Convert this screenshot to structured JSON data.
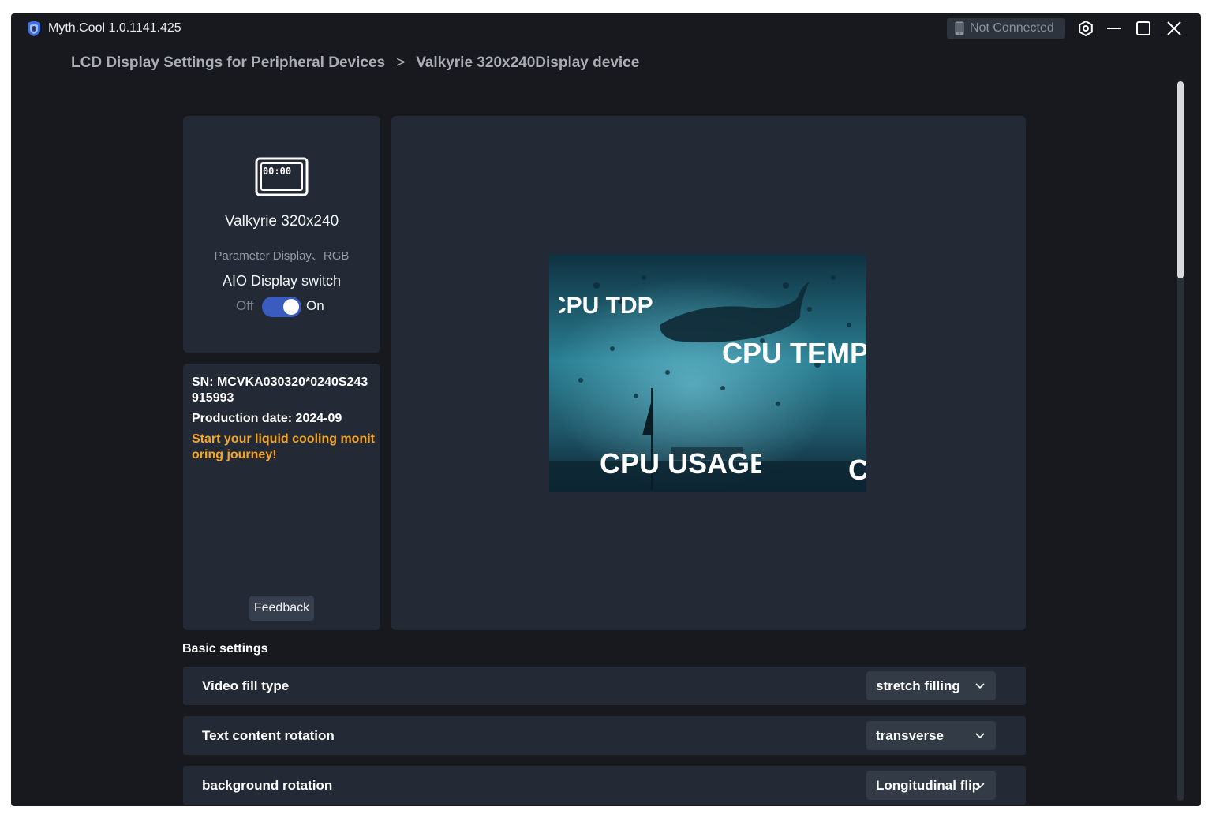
{
  "app": {
    "title": "Myth.Cool 1.0.1141.425",
    "connection_status": "Not Connected"
  },
  "breadcrumb": {
    "parent": "LCD Display Settings for Peripheral Devices",
    "separator": ">",
    "current": "Valkyrie 320x240Display device"
  },
  "device": {
    "icon": "lcd-clock-icon",
    "screen_text": "00:00",
    "name": "Valkyrie 320x240",
    "subtitle": "Parameter Display、RGB",
    "switch_label": "AIO Display switch",
    "switch_off": "Off",
    "switch_on": "On",
    "switch_enabled": true
  },
  "info": {
    "sn": "SN: MCVKA030320*0240S243915993",
    "production_date": "Production date: 2024-09",
    "promo": "Start your liquid cooling monitoring journey!",
    "promo_color": "#f5a623",
    "feedback_label": "Feedback"
  },
  "preview": {
    "labels": [
      "CPU TDP",
      "CPU TEMP",
      "CPU USAGE",
      "C"
    ]
  },
  "settings": {
    "section_title": "Basic settings",
    "rows": [
      {
        "label": "Video fill type",
        "value": "stretch filling"
      },
      {
        "label": "Text content rotation",
        "value": "transverse"
      },
      {
        "label": "background rotation",
        "value": "Longitudinal flip"
      }
    ]
  },
  "colors": {
    "accent": "#3a5bbf",
    "window_bg": "#17191e",
    "panel_bg": "#232a35"
  }
}
